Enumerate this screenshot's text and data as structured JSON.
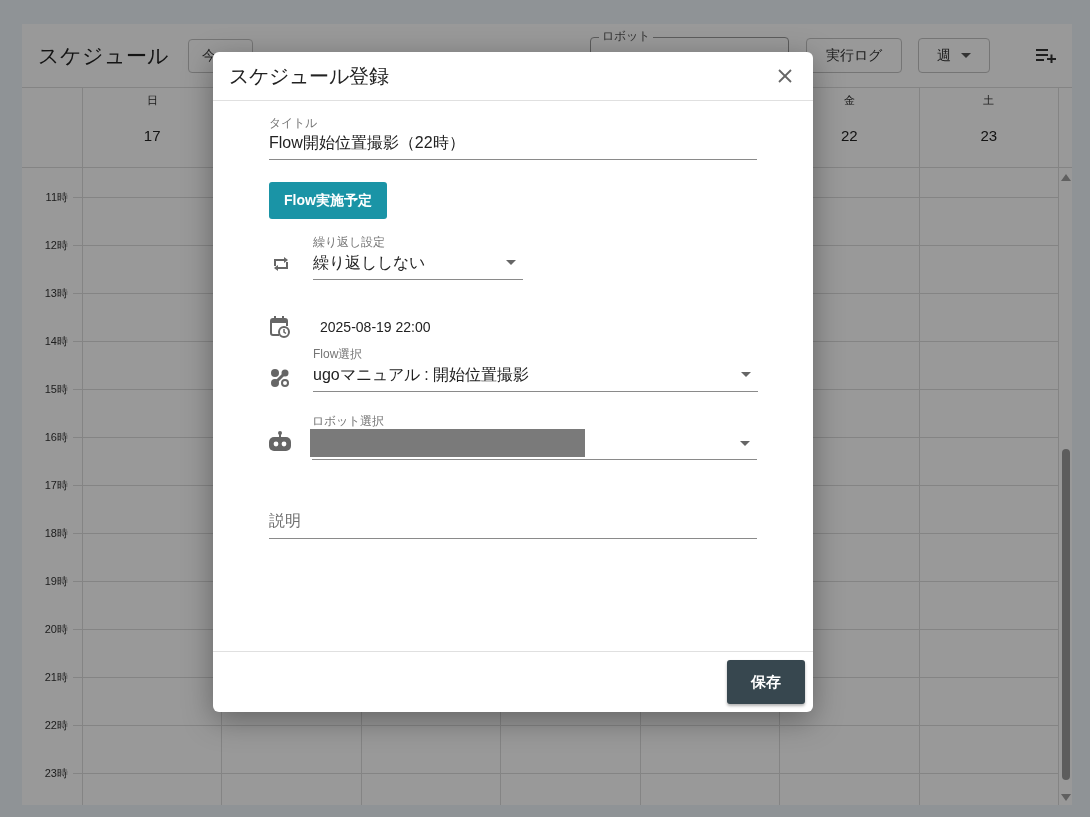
{
  "app_bar": {
    "title": "スケジュール",
    "today_button": "今",
    "robot_filter": {
      "label": "ロボット"
    },
    "log_button": "実行ログ",
    "view_select": {
      "value": "週"
    }
  },
  "calendar": {
    "days": [
      {
        "weekday": "日",
        "date": "17"
      },
      {
        "weekday": "金",
        "date": "22"
      },
      {
        "weekday": "土",
        "date": "23"
      }
    ],
    "hours": [
      "11時",
      "12時",
      "13時",
      "14時",
      "15時",
      "16時",
      "17時",
      "18時",
      "19時",
      "20時",
      "21時",
      "22時",
      "23時"
    ]
  },
  "dialog": {
    "title": "スケジュール登録",
    "title_field": {
      "label": "タイトル",
      "value": "Flow開始位置撮影（22時）"
    },
    "flow_plan_button": "Flow実施予定",
    "repeat_select": {
      "label": "繰り返し設定",
      "value": "繰り返ししない"
    },
    "schedule_datetime": "2025-08-19 22:00",
    "flow_select": {
      "label": "Flow選択",
      "value": "ugoマニュアル : 開始位置撮影"
    },
    "robot_select": {
      "label": "ロボット選択",
      "redacted": true
    },
    "description_field": {
      "placeholder": "説明"
    },
    "save_button": "保存"
  }
}
